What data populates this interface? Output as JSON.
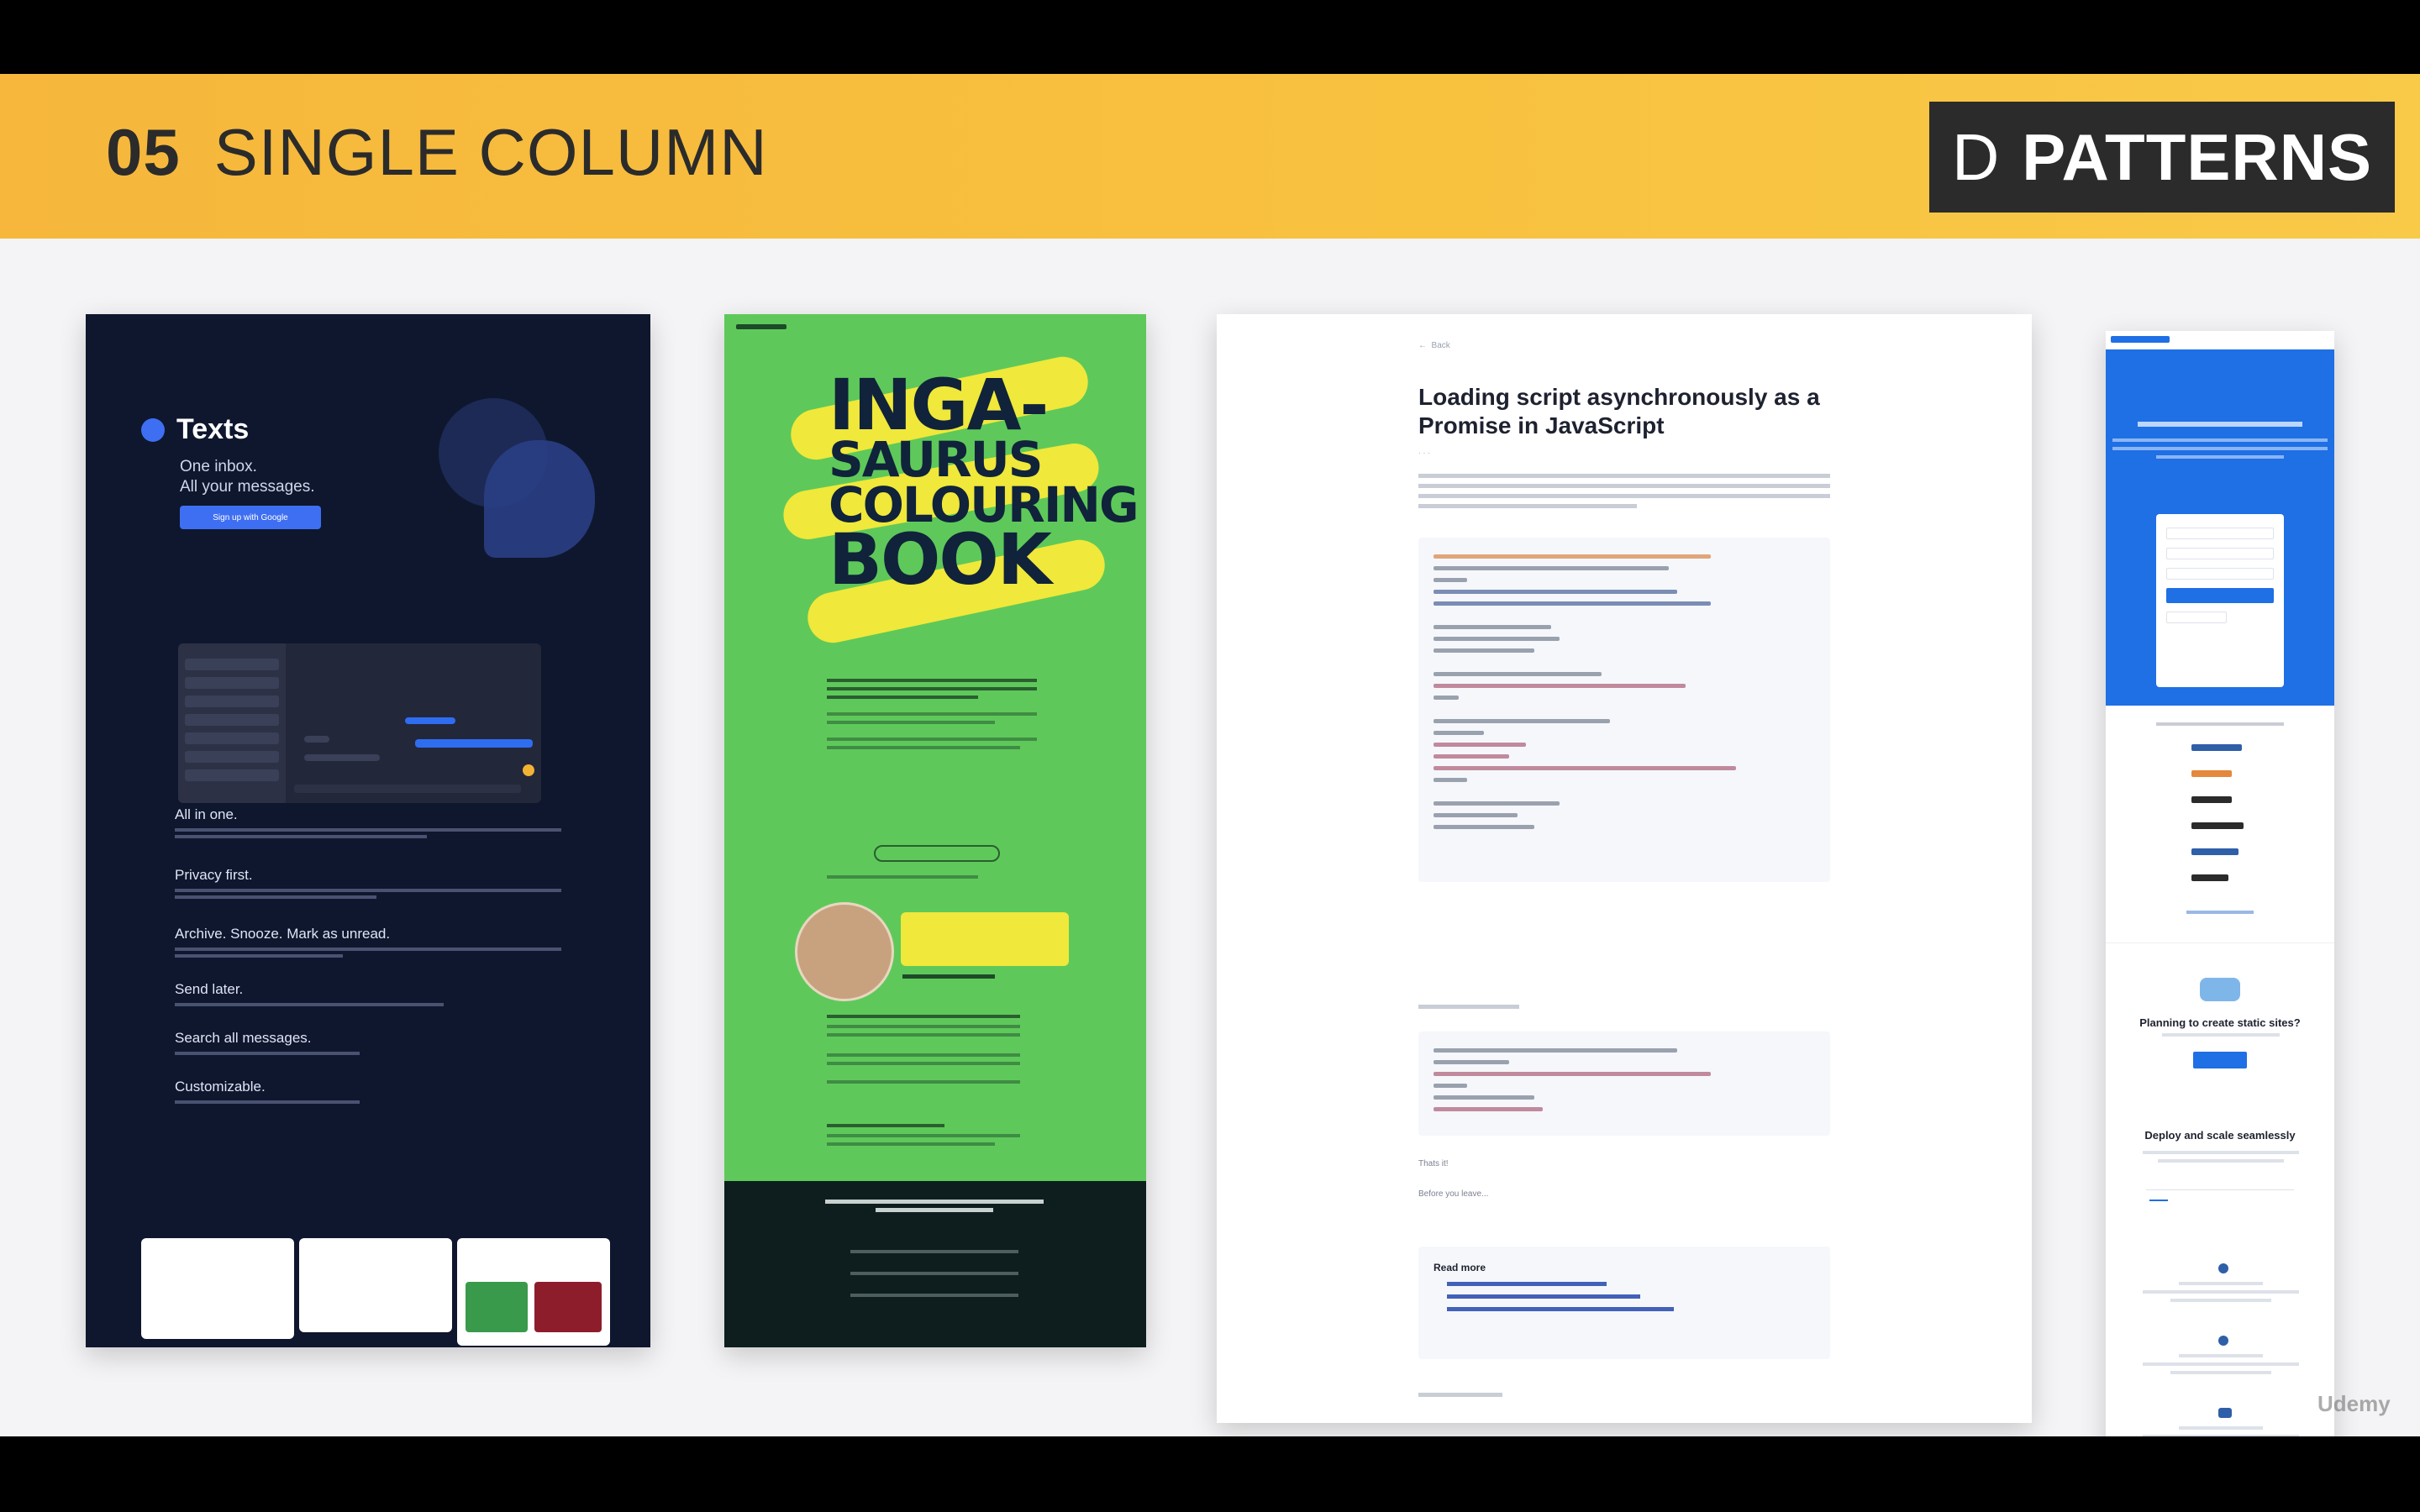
{
  "banner": {
    "number": "05",
    "title": "SINGLE COLUMN",
    "brand_letter": "D",
    "brand_name": "PATTERNS"
  },
  "card_texts": {
    "app_name": "Texts",
    "tagline_line1": "One inbox.",
    "tagline_line2": "All your messages.",
    "signup_button": "Sign up with Google",
    "features": [
      "All in one.",
      "Privacy first.",
      "Archive. Snooze. Mark as unread.",
      "Send later.",
      "Search all messages.",
      "Customizable."
    ]
  },
  "card_book": {
    "title_line1": "INGA-",
    "title_line2": "SAURUS",
    "title_line3": "COLOURING",
    "title_line4": "BOOK"
  },
  "card_article": {
    "title": "Loading script asynchronously as a Promise in JavaScript",
    "read_more": "Read more",
    "thanks_line1": "Thats it!",
    "thanks_line2": "Before you leave..."
  },
  "card_cloud": {
    "headline1": "Planning to create static sites?",
    "headline2": "Deploy and scale seamlessly"
  },
  "watermark": "Udemy",
  "colors": {
    "banner": "#f8c23f",
    "brand_box": "#2b2b2b",
    "texts_bg": "#0f172e",
    "book_green": "#5ec95a",
    "book_yellow": "#f0e83a",
    "cloud_blue": "#1f6fe5"
  }
}
